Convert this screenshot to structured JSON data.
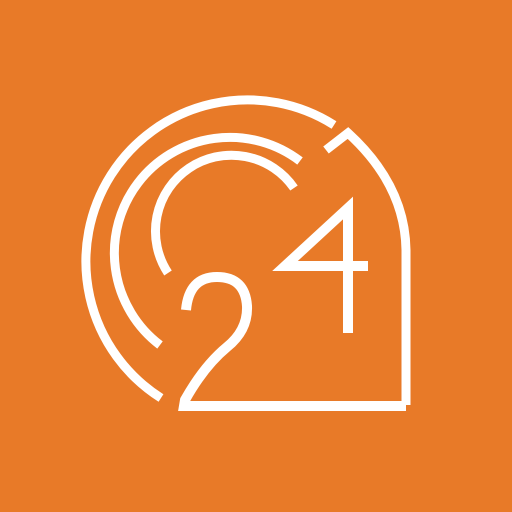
{
  "icon": {
    "logo_text": "24",
    "icon_name": "24-logo-icon",
    "colors": {
      "background": "#E87A28",
      "foreground": "#FFFFFF"
    }
  }
}
